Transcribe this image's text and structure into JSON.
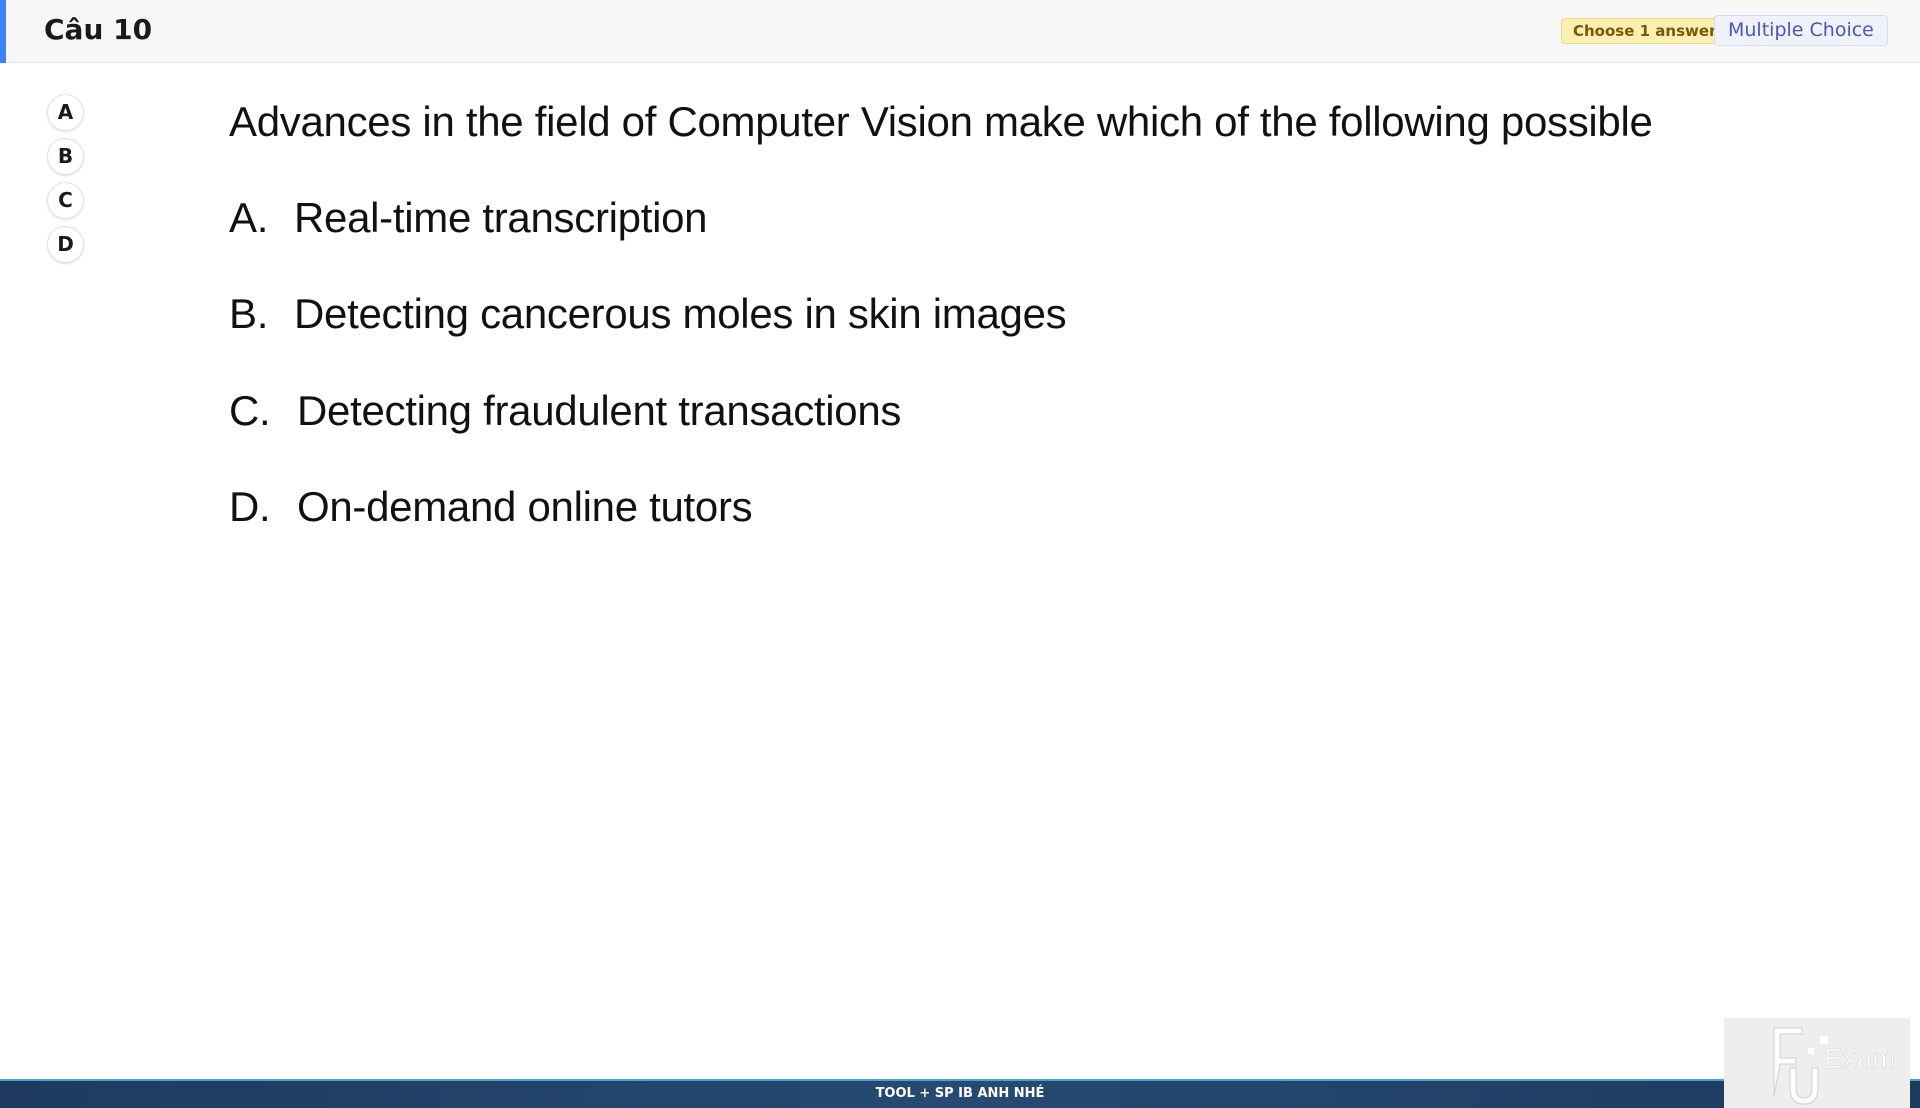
{
  "header": {
    "question_title": "Câu 10",
    "choose_badge": "Choose 1 answer",
    "type_badge": "Multiple Choice"
  },
  "options": [
    {
      "label": "A"
    },
    {
      "label": "B"
    },
    {
      "label": "C"
    },
    {
      "label": "D"
    }
  ],
  "question": {
    "text": "Advances in the field of Computer Vision make which of the following possible",
    "choices": [
      {
        "letter": "A.",
        "text": "Real-time transcription"
      },
      {
        "letter": "B.",
        "text": "Detecting cancerous moles in skin images"
      },
      {
        "letter": "C.",
        "text": "Detecting fraudulent transactions"
      },
      {
        "letter": "D.",
        "text": "On-demand online tutors"
      }
    ]
  },
  "footer": {
    "text": "TOOL + SP IB ANH NHÉ"
  },
  "logo": {
    "text": "Exam",
    "icon": "fu-exam-logo-icon"
  },
  "colors": {
    "accent": "#3b82f6",
    "badge_choose_bg": "#fcefb4",
    "badge_type_text": "#4c55b8",
    "footer_bg": "#1e3a5f"
  }
}
